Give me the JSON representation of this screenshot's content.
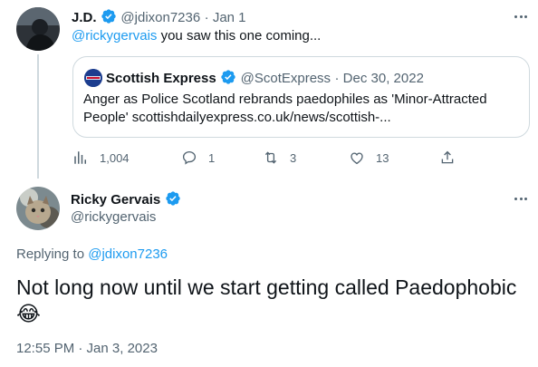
{
  "reply_tweet": {
    "author_name": "J.D.",
    "author_handle": "@jdixon7236",
    "date": "· Jan 1",
    "mention": "@rickygervais",
    "text": " you saw this one coming...",
    "quote": {
      "author_name": "Scottish Express",
      "author_handle": "@ScotExpress",
      "date": "· Dec 30, 2022",
      "text_line1": "Anger as Police Scotland rebrands paedophiles as 'Minor-Attracted",
      "text_line2": "People'  scottishdailyexpress.co.uk/news/scottish-..."
    },
    "actions": {
      "views": "1,004",
      "replies": "1",
      "retweets": "3",
      "likes": "13"
    }
  },
  "main_tweet": {
    "author_name": "Ricky Gervais",
    "author_handle": "@rickygervais",
    "replying_prefix": "Replying to ",
    "replying_handle": "@jdixon7236",
    "text": "Not long now until we start getting called Paedophobic",
    "emoji": "😂",
    "timestamp": "12:55 PM · Jan 3, 2023"
  },
  "colors": {
    "accent": "#1d9bf0",
    "secondary_text": "#536471",
    "border": "#cfd9de"
  }
}
